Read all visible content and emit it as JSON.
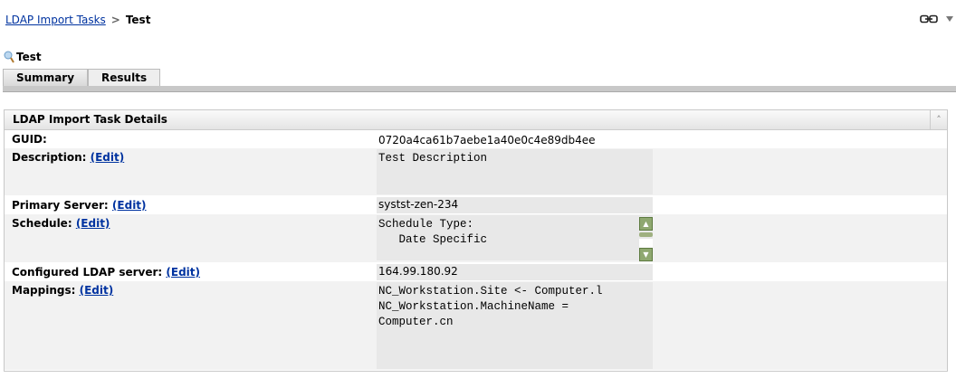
{
  "breadcrumb": {
    "parent": "LDAP Import Tasks",
    "separator": ">",
    "current": "Test"
  },
  "page_title": "Test",
  "tabs": [
    {
      "label": "Summary",
      "active": true
    },
    {
      "label": "Results",
      "active": false
    }
  ],
  "panel": {
    "title": "LDAP Import Task Details"
  },
  "edit_label": "(Edit)",
  "rows": {
    "guid": {
      "label": "GUID:",
      "value": "0720a4ca61b7aebe1a40e0c4e89db4ee"
    },
    "description": {
      "label": "Description:",
      "value": "Test Description"
    },
    "primary_server": {
      "label": "Primary Server:",
      "value": "systst-zen-234"
    },
    "schedule": {
      "label": "Schedule:",
      "value": "Schedule Type:\n   Date Specific"
    },
    "ldap_server": {
      "label": "Configured LDAP server:",
      "value": "164.99.180.92"
    },
    "mappings": {
      "label": "Mappings:",
      "value": "NC_Workstation.Site <- Computer.l\nNC_Workstation.MachineName =\nComputer.cn"
    }
  }
}
